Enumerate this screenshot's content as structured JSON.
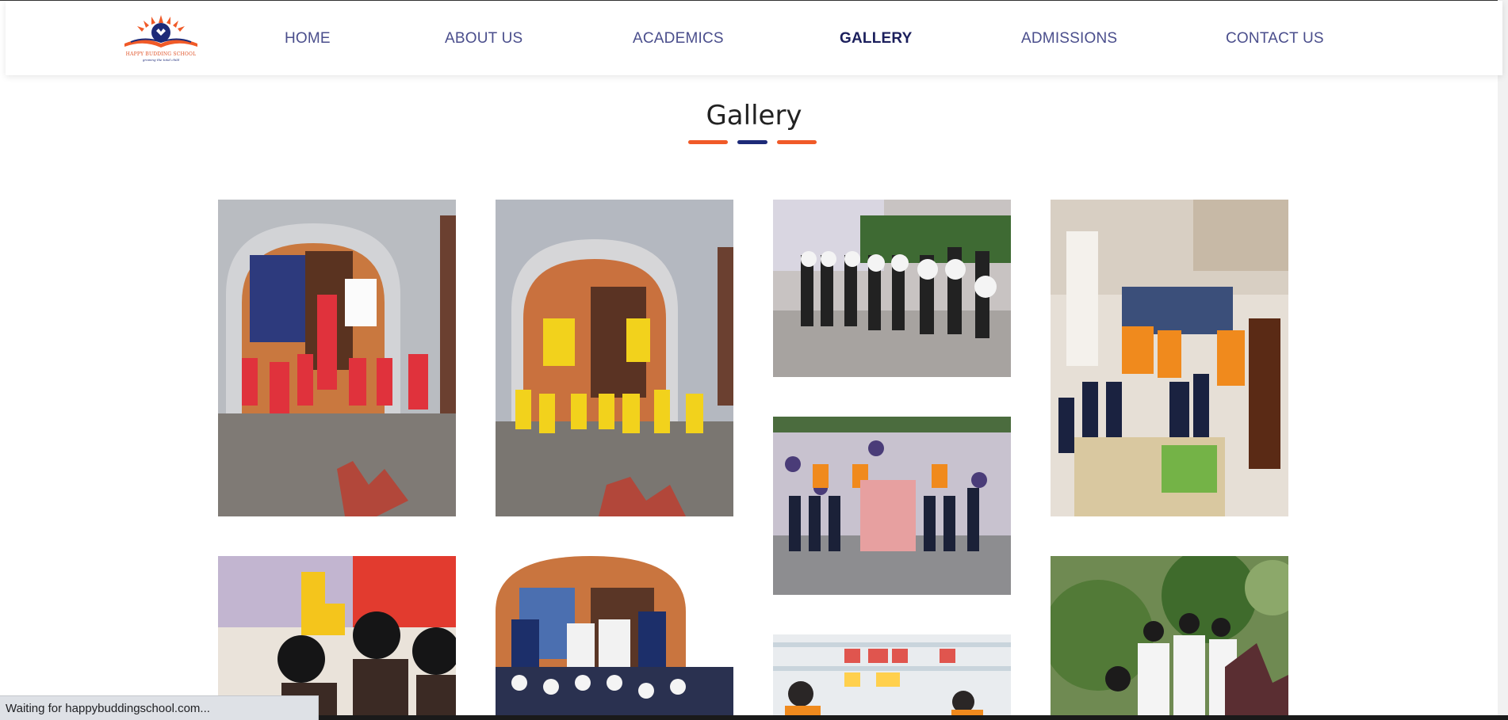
{
  "brand": {
    "name": "HAPPY BUDDING SCHOOL",
    "tagline": "growing the total child",
    "colors": {
      "orange": "#f05a28",
      "navy": "#1d2a78"
    }
  },
  "nav": {
    "items": [
      {
        "label": "HOME",
        "active": false
      },
      {
        "label": "ABOUT US",
        "active": false
      },
      {
        "label": "ACADEMICS",
        "active": false
      },
      {
        "label": "GALLERY",
        "active": true
      },
      {
        "label": "ADMISSIONS",
        "active": false
      },
      {
        "label": "CONTACT US",
        "active": false
      }
    ]
  },
  "page": {
    "title": "Gallery",
    "divider_colors": [
      "#f05a28",
      "#1d2a78",
      "#f05a28"
    ]
  },
  "gallery": {
    "photos": [
      {
        "alt": "colour-day-red-photo"
      },
      {
        "alt": "colour-day-yellow-photo"
      },
      {
        "alt": "children-with-masks-photo"
      },
      {
        "alt": "staff-and-pupils-donation-photo"
      },
      {
        "alt": "group-with-donations-photo"
      },
      {
        "alt": "classroom-children-photo"
      },
      {
        "alt": "teachers-and-pupils-photo"
      },
      {
        "alt": "supermarket-visit-photo"
      },
      {
        "alt": "children-in-garden-photo"
      }
    ]
  },
  "status": {
    "text": "Waiting for happybuddingschool.com..."
  }
}
